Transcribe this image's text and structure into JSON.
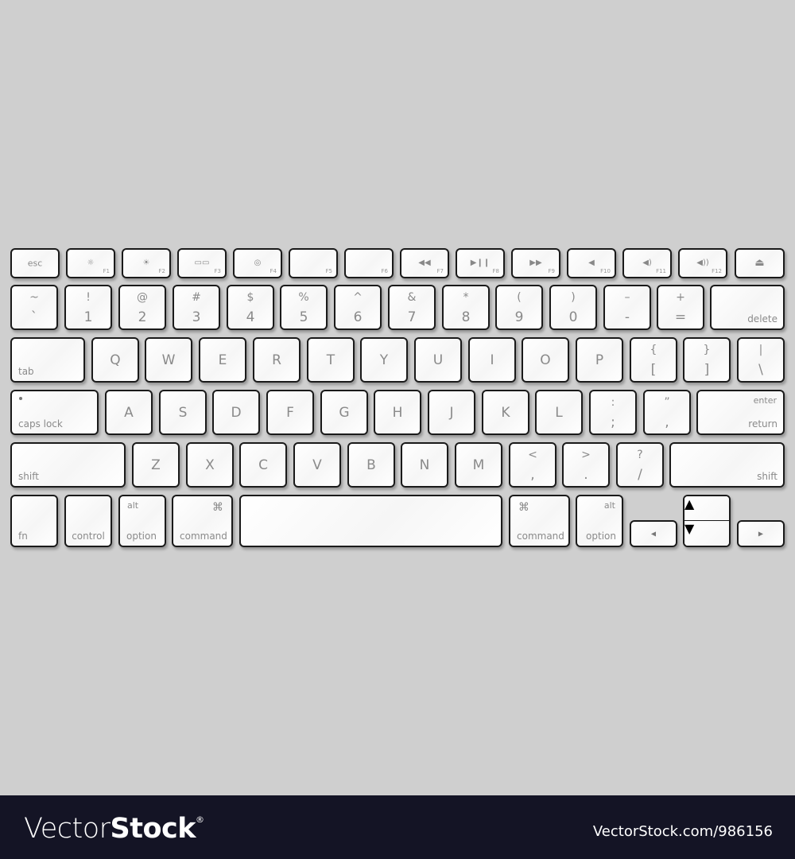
{
  "keyboard": {
    "function_row": [
      {
        "id": "esc",
        "label": "esc"
      },
      {
        "id": "f1",
        "label": "F1",
        "icon": "brightness-down-icon",
        "glyph": "☼"
      },
      {
        "id": "f2",
        "label": "F2",
        "icon": "brightness-up-icon",
        "glyph": "☀"
      },
      {
        "id": "f3",
        "label": "F3",
        "icon": "expose-icon",
        "glyph": "▭▭"
      },
      {
        "id": "f4",
        "label": "F4",
        "icon": "dashboard-icon",
        "glyph": "◎"
      },
      {
        "id": "f5",
        "label": "F5",
        "icon": "",
        "glyph": ""
      },
      {
        "id": "f6",
        "label": "F6",
        "icon": "",
        "glyph": ""
      },
      {
        "id": "f7",
        "label": "F7",
        "icon": "rewind-icon",
        "glyph": "◀◀"
      },
      {
        "id": "f8",
        "label": "F8",
        "icon": "play-pause-icon",
        "glyph": "▶❙❙"
      },
      {
        "id": "f9",
        "label": "F9",
        "icon": "fast-forward-icon",
        "glyph": "▶▶"
      },
      {
        "id": "f10",
        "label": "F10",
        "icon": "mute-icon",
        "glyph": "◀"
      },
      {
        "id": "f11",
        "label": "F11",
        "icon": "volume-down-icon",
        "glyph": "◀)"
      },
      {
        "id": "f12",
        "label": "F12",
        "icon": "volume-up-icon",
        "glyph": "◀))"
      },
      {
        "id": "eject",
        "label": "",
        "icon": "eject-icon",
        "glyph": "⏏"
      }
    ],
    "number_row": [
      {
        "id": "backtick",
        "upper": "~",
        "lower": "`"
      },
      {
        "id": "1",
        "upper": "!",
        "lower": "1"
      },
      {
        "id": "2",
        "upper": "@",
        "lower": "2"
      },
      {
        "id": "3",
        "upper": "#",
        "lower": "3"
      },
      {
        "id": "4",
        "upper": "$",
        "lower": "4"
      },
      {
        "id": "5",
        "upper": "%",
        "lower": "5"
      },
      {
        "id": "6",
        "upper": "^",
        "lower": "6"
      },
      {
        "id": "7",
        "upper": "&",
        "lower": "7"
      },
      {
        "id": "8",
        "upper": "*",
        "lower": "8"
      },
      {
        "id": "9",
        "upper": "(",
        "lower": "9"
      },
      {
        "id": "0",
        "upper": ")",
        "lower": "0"
      },
      {
        "id": "minus",
        "upper": "–",
        "lower": "-"
      },
      {
        "id": "equals",
        "upper": "+",
        "lower": "="
      },
      {
        "id": "delete",
        "label": "delete"
      }
    ],
    "qwerty_row": {
      "tab": "tab",
      "letters": [
        "Q",
        "W",
        "E",
        "R",
        "T",
        "Y",
        "U",
        "I",
        "O",
        "P"
      ],
      "brackets": [
        {
          "upper": "{",
          "lower": "["
        },
        {
          "upper": "}",
          "lower": "]"
        },
        {
          "upper": "|",
          "lower": "\\"
        }
      ]
    },
    "home_row": {
      "caps": "caps lock",
      "letters": [
        "A",
        "S",
        "D",
        "F",
        "G",
        "H",
        "J",
        "K",
        "L"
      ],
      "punct": [
        {
          "upper": ":",
          "lower": ";"
        },
        {
          "upper": "”",
          "lower": ","
        }
      ],
      "return_upper": "enter",
      "return_lower": "return"
    },
    "bottom_letter_row": {
      "shift_left": "shift",
      "letters": [
        "Z",
        "X",
        "C",
        "V",
        "B",
        "N",
        "M"
      ],
      "punct": [
        {
          "upper": "<",
          "lower": ","
        },
        {
          "upper": ">",
          "lower": "."
        },
        {
          "upper": "?",
          "lower": "/"
        }
      ],
      "shift_right": "shift"
    },
    "modifier_row": {
      "fn": "fn",
      "control": "control",
      "option_left": {
        "upper": "alt",
        "lower": "option"
      },
      "command_left": {
        "symbol": "⌘",
        "lower": "command"
      },
      "space": "",
      "command_right": {
        "symbol": "⌘",
        "lower": "command"
      },
      "option_right": {
        "upper": "alt",
        "lower": "option"
      },
      "arrows": {
        "left": "◀",
        "up": "▲",
        "down": "▼",
        "right": "▶"
      }
    }
  },
  "footer": {
    "brand_thin": "Vector",
    "brand_bold": "Stock",
    "brand_mark": "®",
    "image_id": "VectorStock.com/986156"
  }
}
